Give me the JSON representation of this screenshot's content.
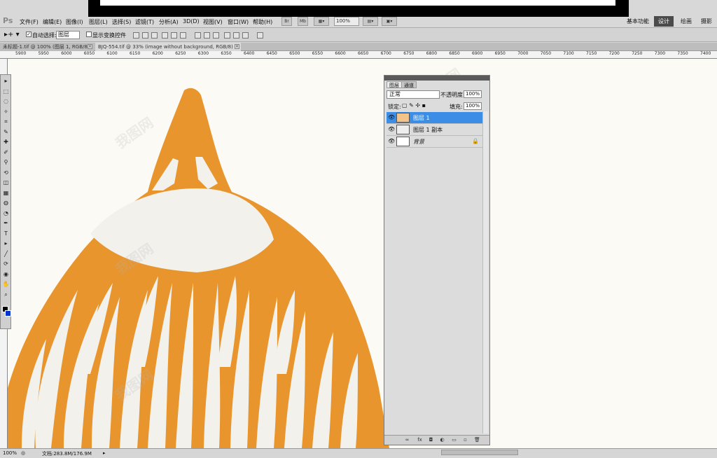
{
  "app": {
    "logo": "Ps",
    "menus": [
      "文件(F)",
      "编辑(E)",
      "图像(I)",
      "图层(L)",
      "选择(S)",
      "滤镜(T)",
      "分析(A)",
      "3D(D)",
      "视图(V)",
      "窗口(W)",
      "帮助(H)"
    ],
    "bridge_buttons": [
      "Br",
      "Mb"
    ],
    "zoom_level": "100%",
    "workspaces": [
      "基本功能",
      "设计",
      "绘画",
      "摄影"
    ],
    "active_workspace": "设计"
  },
  "options_bar": {
    "auto_select_label": "自动选择:",
    "auto_select_checked": true,
    "auto_select_target": "图层",
    "show_transform_label": "显示变换控件",
    "show_transform_checked": false
  },
  "document_tabs": [
    {
      "label": "未标题-1.tif @ 100% (图层 1, RGB/8)",
      "active": false
    },
    {
      "label": "BJQ-554.tif @ 33% (image without background, RGB/8) *",
      "active": true
    }
  ],
  "ruler": {
    "ticks": [
      "5900",
      "5950",
      "6000",
      "6050",
      "6100",
      "6150",
      "6200",
      "6250",
      "6300",
      "6350",
      "6400",
      "6450",
      "6500",
      "6550",
      "6600",
      "6650",
      "6700",
      "6750",
      "6800",
      "6850",
      "6900",
      "6950",
      "7000",
      "7050",
      "7100",
      "7150",
      "7200",
      "7250",
      "7300",
      "7350",
      "7400"
    ]
  },
  "tools": [
    "move",
    "marquee",
    "lasso",
    "quick-select",
    "crop",
    "eyedropper",
    "spot-heal",
    "brush",
    "stamp",
    "history-brush",
    "eraser",
    "gradient",
    "blur",
    "dodge",
    "pen",
    "type",
    "path-select",
    "shape",
    "3d-rotate",
    "3d-orbit",
    "hand",
    "zoom"
  ],
  "colors": {
    "artwork_orange": "#e8952e",
    "canvas_bg": "#fbfaf4",
    "fur_white": "#f2f1ec",
    "selection_blue": "#3c8de6",
    "foreground": "#000000",
    "background": "#0033cc"
  },
  "layers_panel": {
    "tabs": [
      "图层",
      "通道"
    ],
    "blend_mode": "正常",
    "opacity_label": "不透明度:",
    "opacity_value": "100%",
    "lock_label": "锁定:",
    "fill_label": "填充:",
    "fill_value": "100%",
    "layers": [
      {
        "name": "图层 1",
        "selected": true,
        "locked": false,
        "visible": true
      },
      {
        "name": "图层 1 副本",
        "selected": false,
        "locked": false,
        "visible": true
      },
      {
        "name": "背景",
        "selected": false,
        "locked": true,
        "visible": true
      }
    ]
  },
  "status": {
    "zoom": "100%",
    "doc_info": "文档:283.8M/176.9M"
  }
}
